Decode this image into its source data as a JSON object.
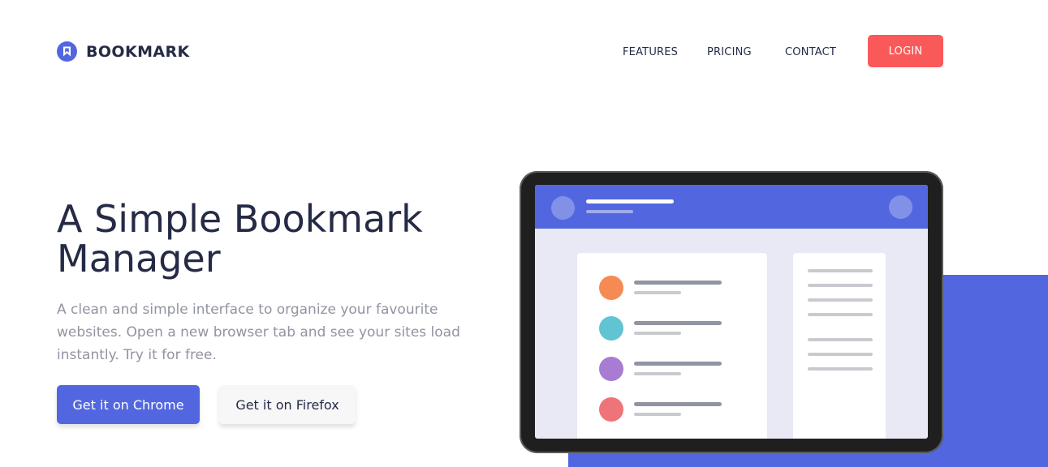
{
  "brand": {
    "name": "BOOKMARK",
    "icon": "bookmark-icon",
    "accent": "#5267df"
  },
  "nav": {
    "features": "FEATURES",
    "pricing": "PRICING",
    "contact": "CONTACT",
    "login": "LOGIN"
  },
  "hero": {
    "title": "A Simple Bookmark Manager",
    "description": "A clean and simple interface to organize your favourite websites. Open a new browser tab and see your sites load instantly. Try it for free.",
    "chrome_button": "Get it on Chrome",
    "firefox_button": "Get it on Firefox"
  },
  "colors": {
    "primary": "#5267df",
    "secondary": "#fa5959",
    "text_dark": "#252b46",
    "text_gray": "#9194a1",
    "illustration_dots": [
      "#f58a55",
      "#61c4d2",
      "#a87cd2",
      "#ef7479"
    ]
  }
}
